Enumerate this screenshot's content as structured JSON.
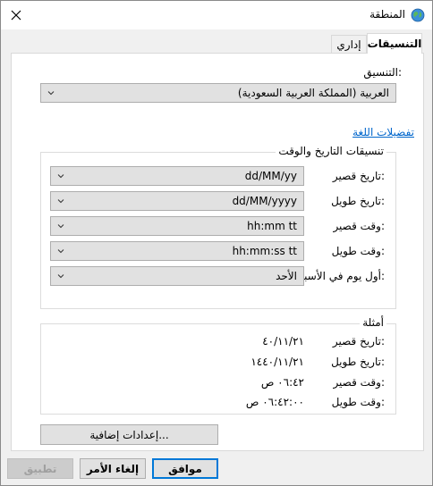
{
  "window": {
    "title": "المنطقة",
    "close_glyph": "✕",
    "icon": "globe-icon"
  },
  "tabs": [
    {
      "label": "التنسيقات",
      "active": true
    },
    {
      "label": "إداري",
      "active": false
    }
  ],
  "format": {
    "label": "التنسيق:",
    "value": "العربية (المملكة العربية السعودية)"
  },
  "language_prefs_link": "تفضيلات اللغة",
  "datetime_group": {
    "title": "تنسيقات التاريخ والوقت",
    "rows": [
      {
        "label": "تاريخ قصير:",
        "value": "dd/MM/yy"
      },
      {
        "label": "تاريخ طويل:",
        "value": "dd/MM/yyyy"
      },
      {
        "label": "وقت قصير:",
        "value": "hh:mm tt"
      },
      {
        "label": "وقت طويل:",
        "value": "hh:mm:ss tt"
      },
      {
        "label": "أول يوم في الأسبوع:",
        "value": "الأحد"
      }
    ]
  },
  "examples_group": {
    "title": "أمثلة",
    "rows": [
      {
        "label": "تاريخ قصير:",
        "value": "٤٠/١١/٢١"
      },
      {
        "label": "تاريخ طويل:",
        "value": "١٤٤٠/١١/٢١"
      },
      {
        "label": "وقت قصير:",
        "value": "٠٦:٤٢ ص"
      },
      {
        "label": "وقت طويل:",
        "value": "٠٦:٤٢:٠٠ ص"
      }
    ]
  },
  "buttons": {
    "additional_settings": "إعدادات إضافية...",
    "ok": "موافق",
    "cancel": "إلغاء الأمر",
    "apply": "تطبيق"
  },
  "colors": {
    "accent": "#0078d7",
    "link": "#0066cc"
  }
}
